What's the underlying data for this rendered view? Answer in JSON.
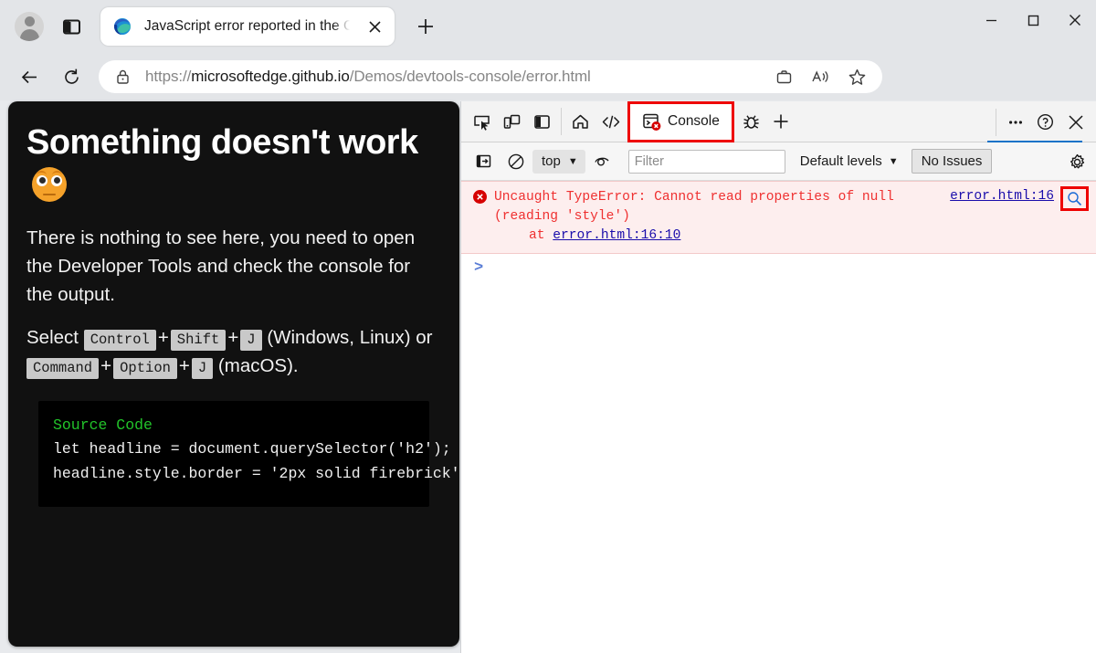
{
  "browser": {
    "tab": {
      "title": "JavaScript error reported in the C",
      "favicon": "edge-logo-icon",
      "close_icon": "close-icon"
    },
    "new_tab_label": "+",
    "address": {
      "scheme": "https://",
      "host": "microsoftedge.github.io",
      "path": "/Demos/devtools-console/error.html",
      "lock_icon": "lock-icon"
    },
    "toolbar_icons": {
      "profile": "profile-avatar-icon",
      "tab_actions": "tab-actions-icon",
      "back": "back-arrow-icon",
      "reload": "reload-icon",
      "collections_omni": "briefcase-icon",
      "read_aloud": "read-aloud-icon",
      "favorite": "star-icon",
      "split_screen": "split-screen-icon",
      "collections": "collections-add-icon",
      "settings_more": "more-options-icon"
    },
    "window_controls": {
      "minimize": "minimize-icon",
      "maximize": "maximize-icon",
      "close": "window-close-icon"
    }
  },
  "page": {
    "heading": "Something doesn't work",
    "heading_emoji": "face-with-raised-eyebrow-emoji",
    "paragraph1": "There is nothing to see here, you need to open the Developer Tools and check the console for the output.",
    "shortcut_intro": "Select",
    "keys_windows": [
      "Control",
      "Shift",
      "J"
    ],
    "platform_windows": "(Windows, Linux) or",
    "keys_mac": [
      "Command",
      "Option",
      "J"
    ],
    "platform_mac": "(macOS).",
    "plus": "+",
    "code": {
      "title": "Source Code",
      "line1": "let headline = document.querySelector('h2');",
      "line2": "headline.style.border = '2px solid firebrick'"
    }
  },
  "devtools": {
    "tabs": {
      "inspect_icon": "inspect-element-icon",
      "device_icon": "device-emulation-icon",
      "dock_icon": "dock-side-icon",
      "home_icon": "home-icon",
      "elements_icon": "elements-code-icon",
      "console_label": "Console",
      "console_icon": "console-error-icon",
      "debugger_icon": "bug-debugger-icon",
      "more_tools_icon": "add-tool-icon",
      "more_icon": "more-options-icon",
      "help_icon": "help-icon",
      "close_icon": "close-devtools-icon"
    },
    "filterbar": {
      "sidebar_icon": "console-sidebar-icon",
      "clear_icon": "clear-console-icon",
      "context": "top",
      "context_caret": "▼",
      "live_expression_icon": "eye-live-expression-icon",
      "filter_placeholder": "Filter",
      "filter_value": "",
      "levels_label": "Default levels",
      "levels_caret": "▼",
      "issues_label": "No Issues",
      "settings_icon": "gear-icon"
    },
    "console": {
      "error_icon": "error-circle-icon",
      "error_message": "Uncaught TypeError: Cannot read properties of null (reading 'style')",
      "stack_prefix": "at ",
      "stack_link": "error.html:16:10",
      "source_link": "error.html:16",
      "search_icon": "search-magnifier-icon",
      "prompt": ">"
    },
    "highlight_color": "#ee0000",
    "active_tab_underline_color": "#1a73c8"
  }
}
